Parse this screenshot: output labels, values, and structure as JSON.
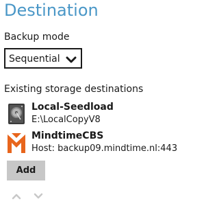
{
  "page": {
    "title": "Destination"
  },
  "backup_mode": {
    "label": "Backup mode",
    "selected": "Sequential"
  },
  "destinations": {
    "label": "Existing storage destinations",
    "items": [
      {
        "name": "Local-Seedload",
        "detail": "E:\\LocalCopyV8",
        "icon": "hard-drive-icon"
      },
      {
        "name": "MindtimeCBS",
        "detail": "Host: backup09.mindtime.nl:443",
        "icon": "mindtime-logo-icon"
      }
    ]
  },
  "actions": {
    "add_label": "Add",
    "move_up_icon": "chevron-up-icon",
    "move_down_icon": "chevron-down-icon"
  },
  "colors": {
    "title": "#4a97c7",
    "mindtime_orange": "#e8651c",
    "button_bg": "#c7c7c7",
    "arrow_disabled": "#c8c8c8"
  }
}
